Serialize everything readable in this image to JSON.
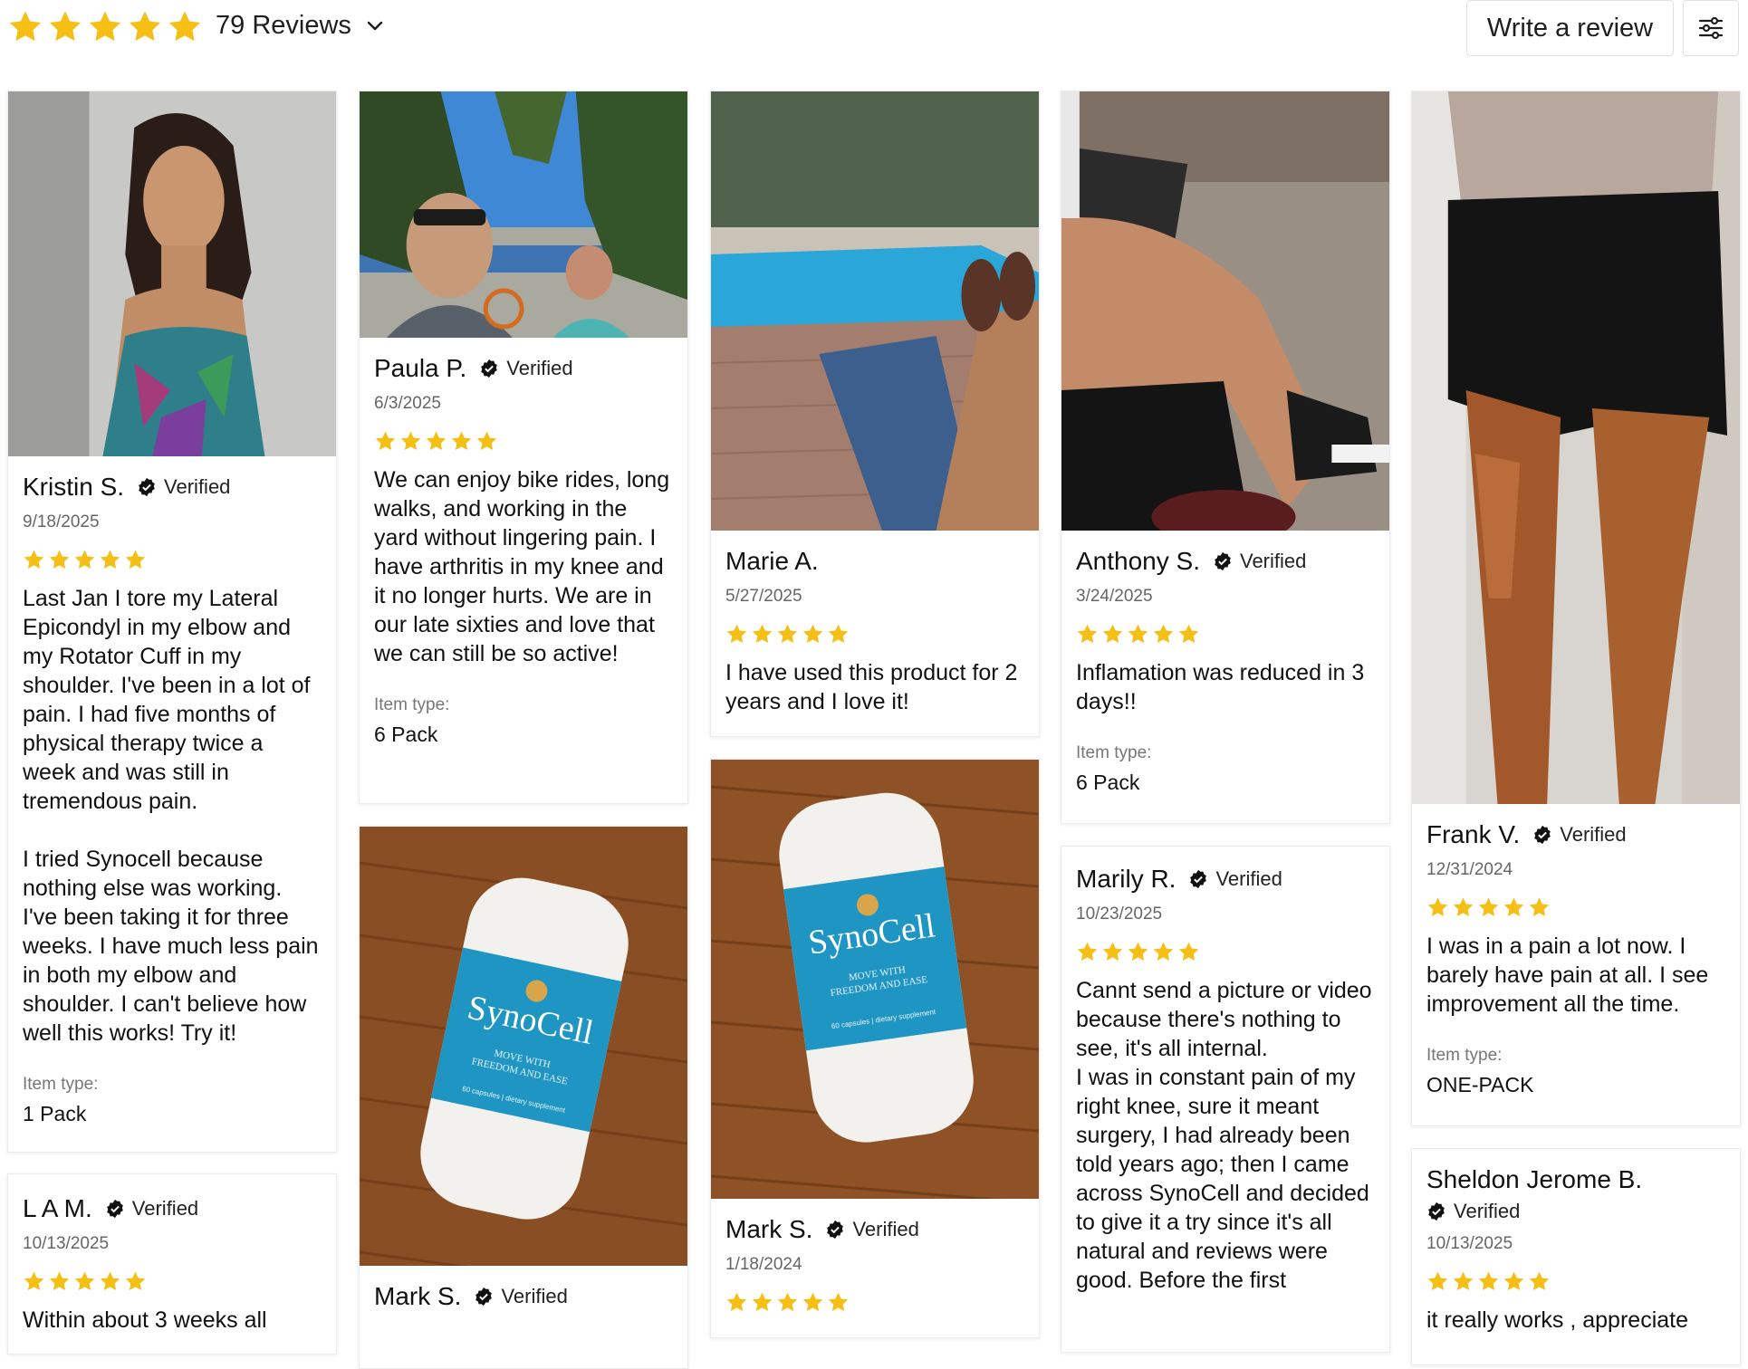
{
  "header": {
    "rating": 5,
    "reviews_label": "79 Reviews",
    "write_review_label": "Write a review",
    "star_color": "#f5bf16"
  },
  "item_type_label": "Item type:",
  "verified_label": "Verified",
  "reviews": [
    {
      "name": "Kristin S.",
      "verified": true,
      "date": "9/18/2025",
      "rating": 5,
      "text": "Last Jan I tore my Lateral Epicondyl in my elbow and my Rotator Cuff in my shoulder. I've been in a lot of pain. I had five months of physical therapy twice a week and was still in tremendous pain.",
      "text2": "I tried Synocell because nothing else was working. I've been taking it for three weeks. I have much less pain in both my elbow and shoulder. I can't believe how well this works! Try it!",
      "item_type": "1 Pack"
    },
    {
      "name": "L A M.",
      "verified": true,
      "date": "10/13/2025",
      "rating": 5,
      "text": "Within about 3 weeks all"
    },
    {
      "name": "Paula P.",
      "verified": true,
      "date": "6/3/2025",
      "rating": 5,
      "text": "We can enjoy bike rides, long walks, and working in the yard without lingering pain. I have arthritis in my knee and it no longer hurts. We are in our late sixties and love that we can still be so active!",
      "item_type": "6 Pack"
    },
    {
      "name": "Mark S.",
      "verified": true
    },
    {
      "name": "Marie A.",
      "verified": false,
      "date": "5/27/2025",
      "rating": 5,
      "text": "I have used this product for 2 years and I love it!"
    },
    {
      "name": "Mark S.",
      "verified": true,
      "date": "1/18/2024",
      "rating": 5
    },
    {
      "name": "Anthony S.",
      "verified": true,
      "date": "3/24/2025",
      "rating": 5,
      "text": "Inflamation was reduced in 3 days!!",
      "item_type": "6 Pack"
    },
    {
      "name": "Marily R.",
      "verified": true,
      "date": "10/23/2025",
      "rating": 5,
      "text": "Cannt send a picture or video because there's nothing to see, it's all internal.",
      "text2": "I was in constant pain of my right knee, sure it meant surgery, I had already been told years ago; then I came across SynoCell and decided to give it a try since it's all natural and reviews were good.  Before the first"
    },
    {
      "name": "Frank V.",
      "verified": true,
      "date": "12/31/2024",
      "rating": 5,
      "text": "I was in a pain a lot now. I barely have pain at all. I see improvement all the time.",
      "item_type": "ONE-PACK"
    },
    {
      "name": "Sheldon Jerome B.",
      "verified": true,
      "date": "10/13/2025",
      "rating": 5,
      "text": "it really works , appreciate"
    }
  ],
  "product_label": {
    "brand": "SynoCell",
    "tagline_1": "MOVE WITH",
    "tagline_2": "FREEDOM AND EASE",
    "capsules": "60 capsules | dietary supplement"
  }
}
